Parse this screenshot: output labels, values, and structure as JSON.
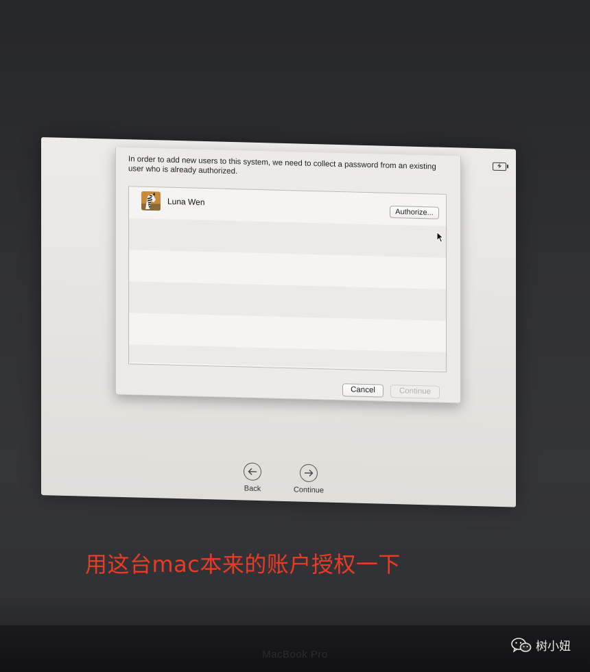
{
  "dialog": {
    "message": "In order to add new users to this system, we need to collect a password from an existing user who is already authorized.",
    "users": [
      {
        "name": "Luna Wen",
        "avatar_icon": "zebra-avatar-icon",
        "action_label": "Authorize..."
      }
    ],
    "cancel_label": "Cancel",
    "continue_label": "Continue"
  },
  "setup_nav": {
    "back_label": "Back",
    "continue_label": "Continue"
  },
  "annotation": {
    "caption": "用这台mac本来的账户授权一下",
    "color": "#ea3b25"
  },
  "device": {
    "model": "MacBook Pro"
  },
  "watermark": {
    "text": "树小妞",
    "icon": "wechat-icon"
  },
  "colors": {
    "screen_background": "#e6e4e0",
    "desk_background": "#2f3034"
  }
}
